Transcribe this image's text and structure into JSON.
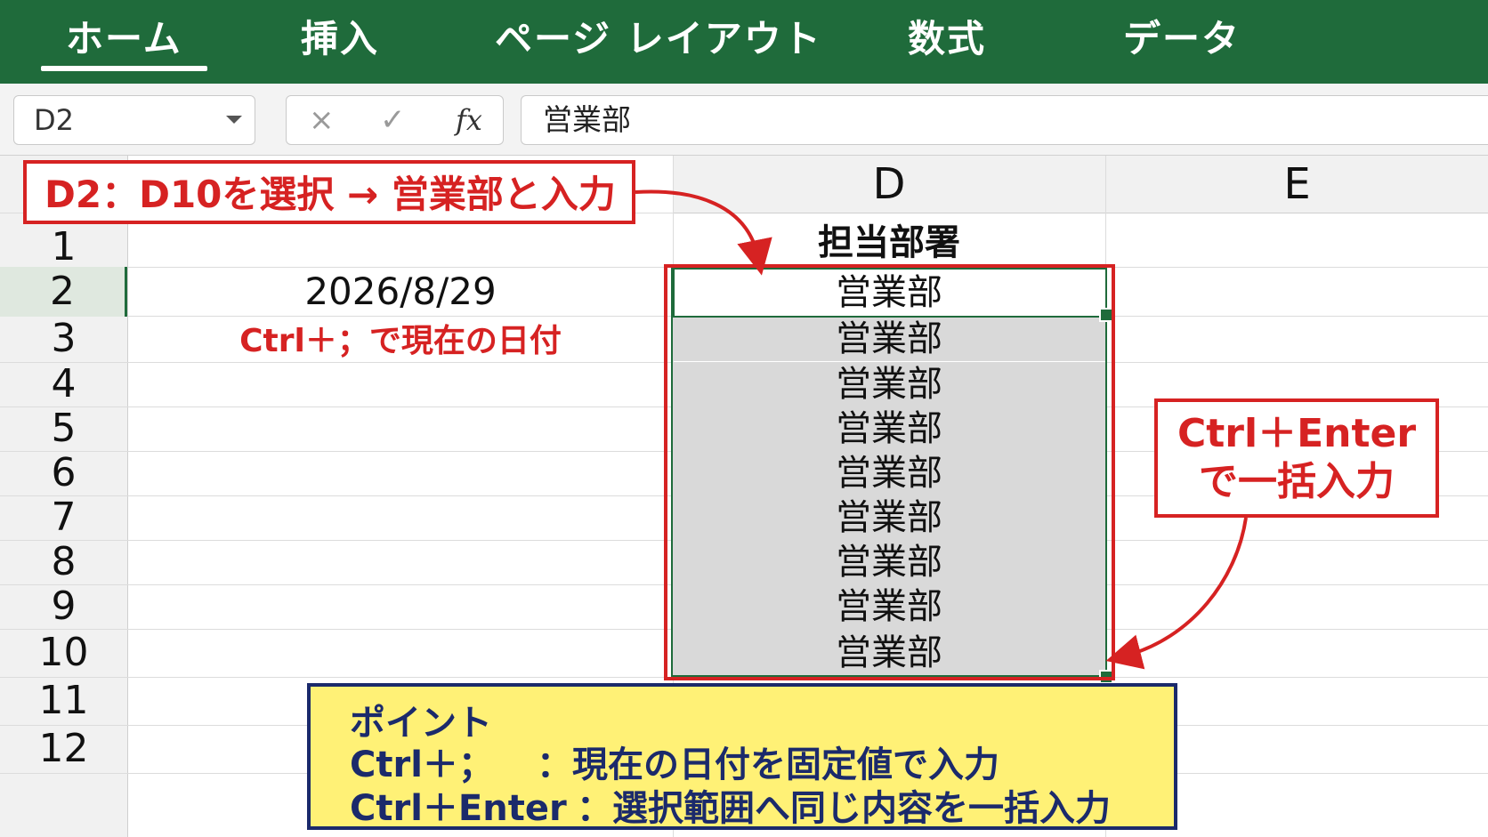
{
  "ribbon": {
    "tabs": [
      "ホーム",
      "挿入",
      "ページ レイアウト",
      "数式",
      "データ"
    ],
    "active_tab": "ホーム",
    "color": "#1f6b3b"
  },
  "formula_bar": {
    "name_box": "D2",
    "cancel_icon": "×",
    "confirm_icon": "✓",
    "fx_label": "fx",
    "content": "営業部"
  },
  "sheet": {
    "columns": [
      "D",
      "E"
    ],
    "row_numbers": [
      "1",
      "2",
      "3",
      "4",
      "5",
      "6",
      "7",
      "8",
      "9",
      "10",
      "11",
      "12"
    ],
    "c2_date": "2026/8/29",
    "c3_note": "Ctrl＋；で現在の日付",
    "d1_header": "担当部署",
    "d_values": [
      "営業部",
      "営業部",
      "営業部",
      "営業部",
      "営業部",
      "営業部",
      "営業部",
      "営業部",
      "営業部"
    ]
  },
  "annotations": {
    "top_callout": "D2：D10を選択 → 営業部と入力",
    "right_callout_line1": "Ctrl＋Enter",
    "right_callout_line2": "で一括入力",
    "accent_red": "#d62222"
  },
  "point_box": {
    "title": "ポイント",
    "line1_key": "Ctrl＋；",
    "line1_desc": "：現在の日付を固定値で入力",
    "line2_key": "Ctrl＋Enter",
    "line2_desc": "：選択範囲へ同じ内容を一括入力",
    "bg_color": "#fff176",
    "border_color": "#1b2a6b"
  }
}
